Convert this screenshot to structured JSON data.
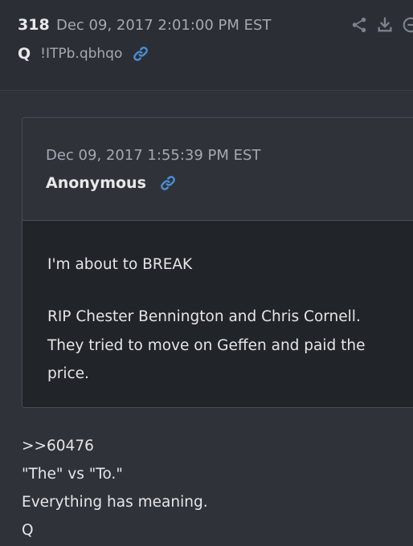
{
  "post": {
    "number": "318",
    "date": "Dec 09, 2017 2:01:00 PM EST",
    "author": "Q",
    "tripcode": "!ITPb.qbhqo",
    "icons": [
      "link-icon",
      "share-icon",
      "download-icon",
      "partial-icon"
    ]
  },
  "quoted_post": {
    "date": "Dec 09, 2017 1:55:39 PM EST",
    "author": "Anonymous",
    "lines": [
      "I'm about to BREAK",
      "RIP Chester Bennington and Chris Cornell.",
      "They tried to move on Geffen and paid the",
      "price."
    ]
  },
  "reply": {
    "lines": [
      ">>60476",
      "\"The\" vs \"To.\"",
      "Everything has meaning.",
      "Q"
    ]
  },
  "colors": {
    "background": "#2f3339",
    "header": "#2b2f35",
    "quote_body": "#212428",
    "link_blue": "#4a8fd6"
  }
}
